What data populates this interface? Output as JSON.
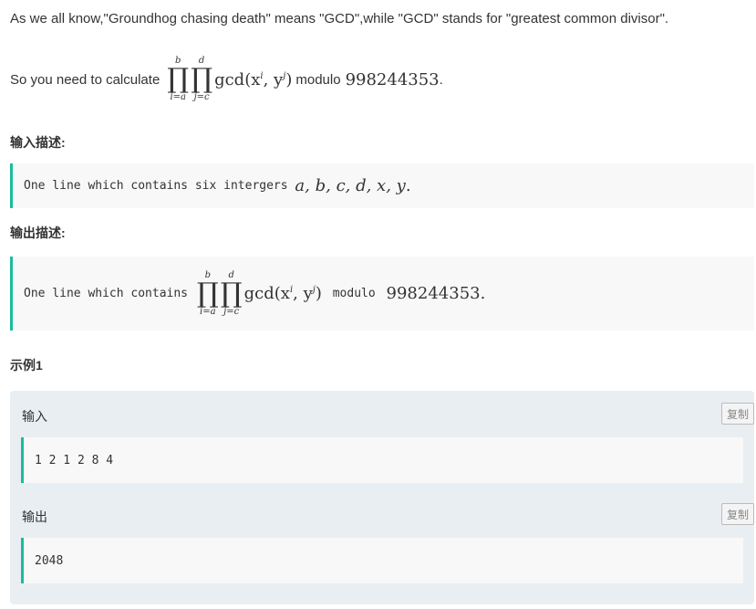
{
  "intro": "As we all know,\"Groundhog chasing death\" means \"GCD\",while \"GCD\" stands for \"greatest common divisor\".",
  "calc": {
    "prefix": "So you need to calculate",
    "prod1_upper": "b",
    "prod1_lower": "i=a",
    "prod2_upper": "d",
    "prod2_lower": "j=c",
    "prod_symbol": "∏",
    "expr": "gcd(x",
    "exp_i": "i",
    "mid": ", y",
    "exp_j": "j",
    "close": ")",
    "modulo": "modulo",
    "modnum": "998244353",
    "end": "."
  },
  "input_desc": {
    "heading": "输入描述:",
    "text": "One line which contains six intergers ",
    "vars": "a, b, c, d, x, y",
    "end": "."
  },
  "output_desc": {
    "heading": "输出描述:",
    "text": "One line which contains ",
    "modulo": " modulo ",
    "modnum": "998244353",
    "end": "."
  },
  "example": {
    "heading": "示例1",
    "input_label": "输入",
    "input_value": "1 2 1 2 8 4",
    "output_label": "输出",
    "output_value": "2048",
    "copy_label": "复制"
  }
}
